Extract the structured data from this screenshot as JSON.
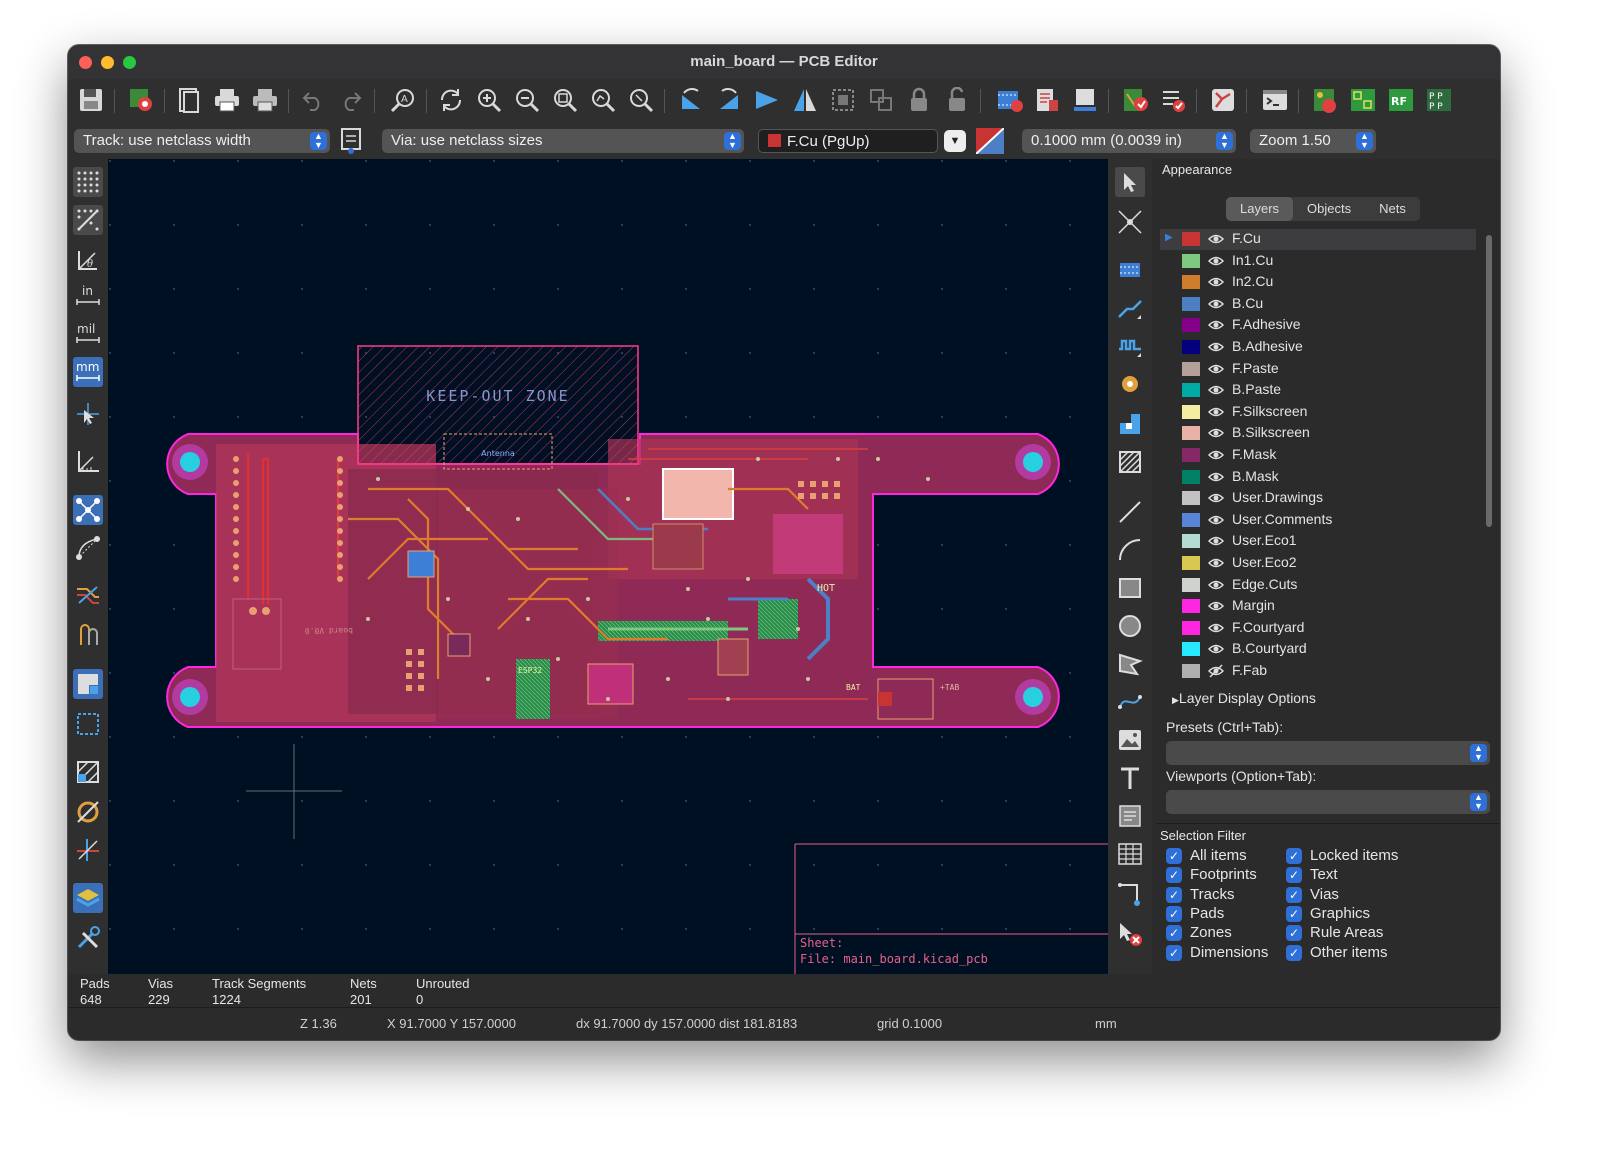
{
  "window": {
    "title": "main_board — PCB Editor"
  },
  "options": {
    "track": "Track: use netclass width",
    "via": "Via: use netclass sizes",
    "layer": "F.Cu (PgUp)",
    "grid": "0.1000 mm (0.0039 in)",
    "zoom": "Zoom 1.50"
  },
  "left_tools": [
    "grid-icon",
    "grid-overrides-icon",
    "polar-coords-icon",
    "units-in-icon",
    "units-mil-icon",
    "units-mm-icon",
    "cursor-icon",
    "measure-icon",
    "ratsnest-icon",
    "curved-ratsnest-icon",
    "show-tracks-icon",
    "show-vias-icon",
    "zone-fill-icon",
    "zone-outline-icon",
    "zone-display-icon",
    "pad-display-icon",
    "hv-45-icon",
    "layers-manager-icon",
    "preferences-icon"
  ],
  "units_labels": {
    "in": "in",
    "mil": "mil",
    "mm": "mm"
  },
  "canvas": {
    "keepout_label": "KEEP-OUT ZONE",
    "antenna_label": "Antenna",
    "titleblock_sheet": "Sheet:",
    "titleblock_file": "File: main_board.kicad_pcb",
    "silk_hot": "HOT",
    "silk_bat": "BAT",
    "silk_tab": "+TAB",
    "silk_esp": "ESP32",
    "silk_board": "board V0.0"
  },
  "panel": {
    "title": "Appearance",
    "tabs": [
      "Layers",
      "Objects",
      "Nets"
    ],
    "active_tab": "Layers",
    "layers": [
      {
        "name": "F.Cu",
        "color": "#c83434"
      },
      {
        "name": "In1.Cu",
        "color": "#7fc87f"
      },
      {
        "name": "In2.Cu",
        "color": "#ce7d2c"
      },
      {
        "name": "B.Cu",
        "color": "#4d7fc4"
      },
      {
        "name": "F.Adhesive",
        "color": "#84008a"
      },
      {
        "name": "B.Adhesive",
        "color": "#05007c"
      },
      {
        "name": "F.Paste",
        "color": "#b4a29a"
      },
      {
        "name": "B.Paste",
        "color": "#00aaa5"
      },
      {
        "name": "F.Silkscreen",
        "color": "#f2eda1"
      },
      {
        "name": "B.Silkscreen",
        "color": "#e8b2a7"
      },
      {
        "name": "F.Mask",
        "color": "#842868"
      },
      {
        "name": "B.Mask",
        "color": "#028066"
      },
      {
        "name": "User.Drawings",
        "color": "#c2c2c2"
      },
      {
        "name": "User.Comments",
        "color": "#5985d9"
      },
      {
        "name": "User.Eco1",
        "color": "#b4dbd2"
      },
      {
        "name": "User.Eco2",
        "color": "#d8c852"
      },
      {
        "name": "Edge.Cuts",
        "color": "#d0d2cd"
      },
      {
        "name": "Margin",
        "color": "#ff26e2"
      },
      {
        "name": "F.Courtyard",
        "color": "#ff26e2"
      },
      {
        "name": "B.Courtyard",
        "color": "#26e9ff"
      },
      {
        "name": "F.Fab",
        "color": "#afafaf"
      }
    ],
    "layer_display_options": "Layer Display Options",
    "presets_label": "Presets (Ctrl+Tab):",
    "viewports_label": "Viewports (Option+Tab):",
    "selection_filter_title": "Selection Filter",
    "filters_left": [
      "All items",
      "Footprints",
      "Tracks",
      "Pads",
      "Zones",
      "Dimensions"
    ],
    "filters_right": [
      "Locked items",
      "Text",
      "Vias",
      "Graphics",
      "Rule Areas",
      "Other items"
    ]
  },
  "status": {
    "pads_label": "Pads",
    "pads": "648",
    "vias_label": "Vias",
    "vias": "229",
    "tracks_label": "Track Segments",
    "tracks": "1224",
    "nets_label": "Nets",
    "nets": "201",
    "unrouted_label": "Unrouted",
    "unrouted": "0",
    "z": "Z 1.36",
    "xy": "X 91.7000  Y 157.0000",
    "dxy": "dx 91.7000  dy 157.0000  dist 181.8183",
    "grid": "grid 0.1000",
    "units": "mm"
  }
}
